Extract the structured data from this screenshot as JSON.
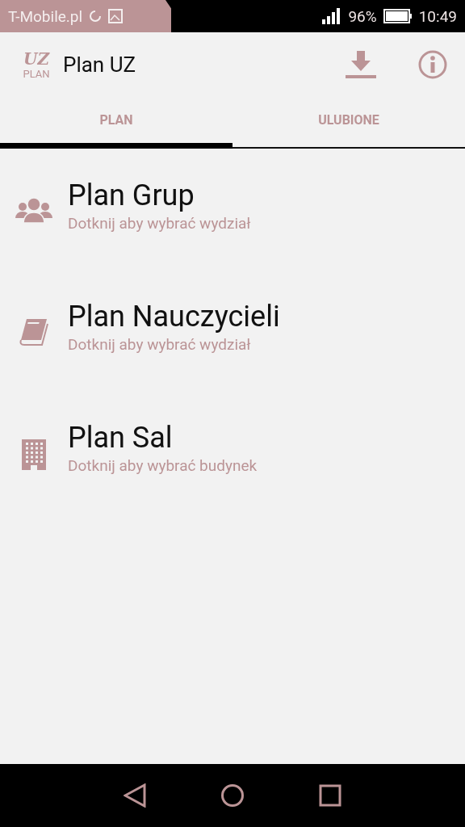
{
  "status_bar": {
    "carrier": "T-Mobile.pl",
    "battery": "96%",
    "time": "10:49"
  },
  "app_bar": {
    "logo_mark": "UZ",
    "logo_caption": "PLAN",
    "title": "Plan UZ"
  },
  "tabs": [
    {
      "label": "PLAN",
      "selected": true
    },
    {
      "label": "ULUBIONE",
      "selected": false
    }
  ],
  "items": [
    {
      "kind": "group",
      "title": "Plan Grup",
      "subtitle": "Dotknij aby wybrać wydział"
    },
    {
      "kind": "book",
      "title": "Plan Nauczycieli",
      "subtitle": "Dotknij aby wybrać wydział"
    },
    {
      "kind": "building",
      "title": "Plan Sal",
      "subtitle": "Dotknij aby wybrać budynek"
    }
  ]
}
